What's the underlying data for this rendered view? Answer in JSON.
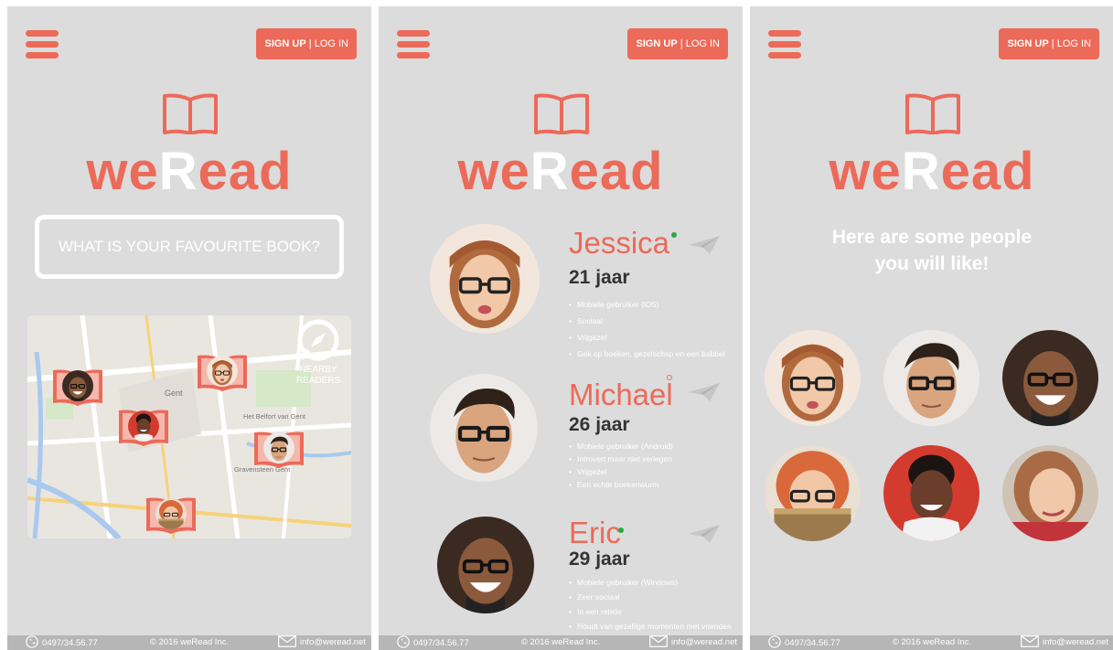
{
  "brand": {
    "part1": "we",
    "part2": "R",
    "part3": "ead"
  },
  "auth": {
    "signup": "SIGN UP",
    "separator": "|",
    "login": "LOG IN"
  },
  "colors": {
    "accent": "#ec6a59",
    "screen_bg": "#dcdcdc",
    "online": "#28a745"
  },
  "icons": [
    "menu-icon",
    "book-icon",
    "compass-icon",
    "paper-plane-icon",
    "phone-icon",
    "mail-icon"
  ],
  "screen1": {
    "search_placeholder": "WHAT IS YOUR FAVOURITE BOOK?",
    "nearby": {
      "line1": "NEARBY",
      "line2": "READERS"
    },
    "map_labels": [
      "Gent",
      "Het Belfort van Gent",
      "Gravensteen Gent"
    ]
  },
  "screen2": {
    "profiles": [
      {
        "name": "Jessica",
        "age": "21 jaar",
        "status": "online",
        "traits": [
          "Mobiele gebruiker (iOS)",
          "Sociaal",
          "Vrijgezel",
          "Gek op boeken, gezelschap en een babbel"
        ]
      },
      {
        "name": "Michael",
        "age": "26 jaar",
        "status": "offline",
        "traits": [
          "Mobiele gebruiker (Android)",
          "Introvert maar niet verlegen",
          "Vrijgezel",
          "Een echte boekenwurm"
        ]
      },
      {
        "name": "Eric",
        "age": "29 jaar",
        "status": "online",
        "traits": [
          "Mobiele gebruiker (Windows)",
          "Zeer sociaal",
          "In een relatie",
          "Houdt van gezellige momenten met vrienden"
        ]
      }
    ]
  },
  "screen3": {
    "headline_line1": "Here are some people",
    "headline_line2": "you will like!"
  },
  "footer": {
    "phone": "0497/34.56.77",
    "copyright": "© 2016 weRead Inc.",
    "email": "info@weread.net"
  }
}
